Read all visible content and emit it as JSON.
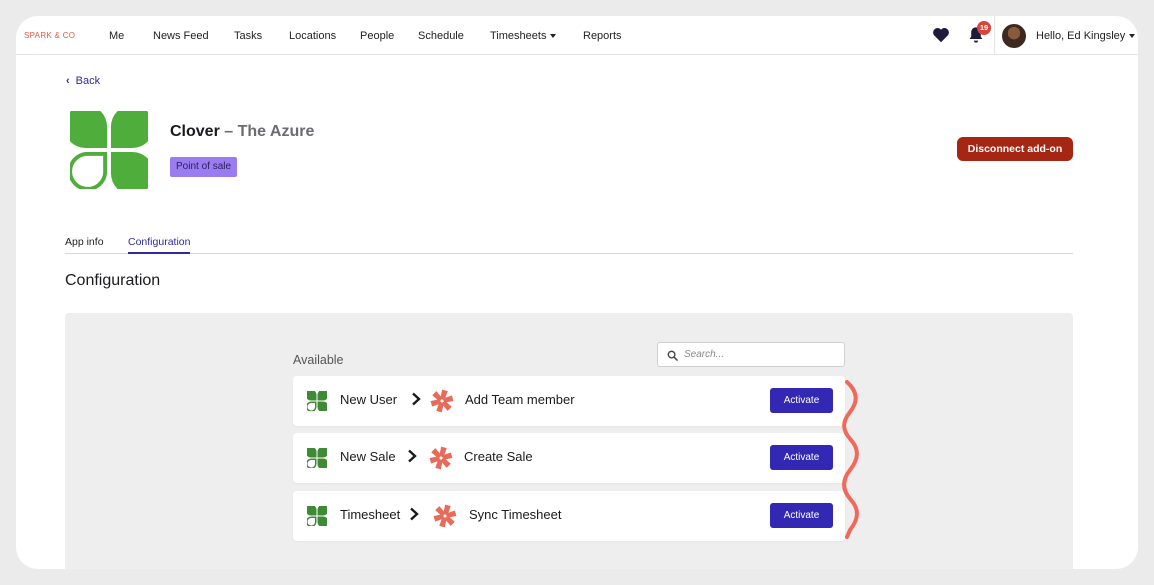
{
  "brand": "SPARK & CO",
  "nav": {
    "items": [
      "Me",
      "News Feed",
      "Tasks",
      "Locations",
      "People",
      "Schedule",
      "Timesheets",
      "Reports"
    ],
    "notifications_count": "19",
    "greeting": "Hello, Ed Kingsley"
  },
  "back_label": "Back",
  "app": {
    "name": "Clover",
    "separator": " – ",
    "location": "The Azure",
    "category_badge": "Point of sale",
    "disconnect_label": "Disconnect add-on",
    "brand_color": "#4fad3b"
  },
  "tabs": [
    {
      "label": "App info",
      "active": false
    },
    {
      "label": "Configuration",
      "active": true
    }
  ],
  "section_title": "Configuration",
  "integrations": {
    "available_label": "Available",
    "search_placeholder": "Search...",
    "activate_label": "Activate",
    "rows": [
      {
        "source": "New User",
        "target": "Add Team member"
      },
      {
        "source": "New Sale",
        "target": "Create Sale"
      },
      {
        "source": "Timesheet",
        "target": "Sync Timesheet"
      }
    ]
  },
  "colors": {
    "accent": "#3328b3",
    "danger": "#a52613",
    "badge_bg": "#9a7cf0",
    "spark": "#e86a5a"
  }
}
